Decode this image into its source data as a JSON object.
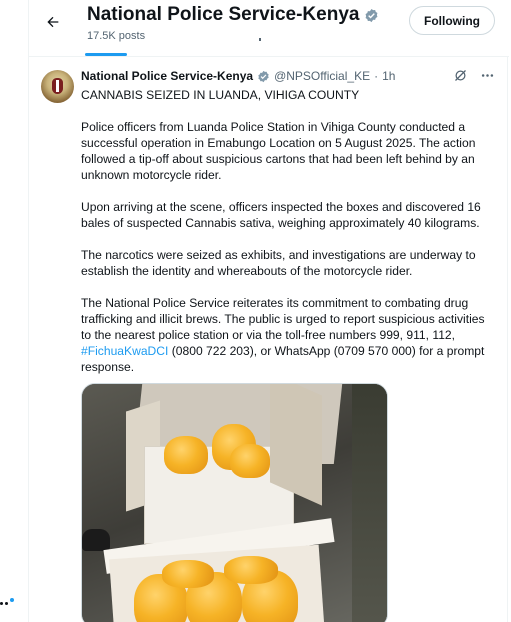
{
  "header": {
    "title": "National Police Service-Kenya",
    "posts_count": "17.5K posts",
    "follow_label": "Following"
  },
  "post": {
    "author_name": "National Police Service-Kenya",
    "handle": "@NPSOfficial_KE",
    "separator": "·",
    "time": "1h",
    "headline": "CANNABIS SEIZED IN LUANDA, VIHIGA COUNTY",
    "para1": "Police officers from Luanda Police Station in Vihiga County conducted a successful operation in Emabungo Location on 5 August 2025. The action followed a tip-off about suspicious cartons that had been left behind by an unknown motorcycle rider.",
    "para2": "Upon arriving at the scene, officers inspected the boxes and discovered 16 bales of suspected Cannabis sativa, weighing approximately 40 kilograms.",
    "para3": "The narcotics were seized as exhibits, and investigations are underway to establish the identity and whereabouts of the motorcycle rider.",
    "para4_before": "The National Police Service reiterates its commitment to combating drug trafficking and illicit brews. The public is urged to report suspicious activities to the nearest police station or via the toll-free numbers 999, 911, 112, ",
    "hashtag": "#FichuaKwaDCI",
    "para4_after": " (0800 722 203), or WhatsApp (0709 570 000) for a prompt response."
  },
  "icons": {
    "back": "arrow-left-icon",
    "verified": "verified-badge-icon",
    "grok": "grok-icon",
    "more": "more-icon"
  },
  "colors": {
    "accent": "#1d9bf0",
    "text": "#0f1419",
    "muted": "#536471"
  }
}
